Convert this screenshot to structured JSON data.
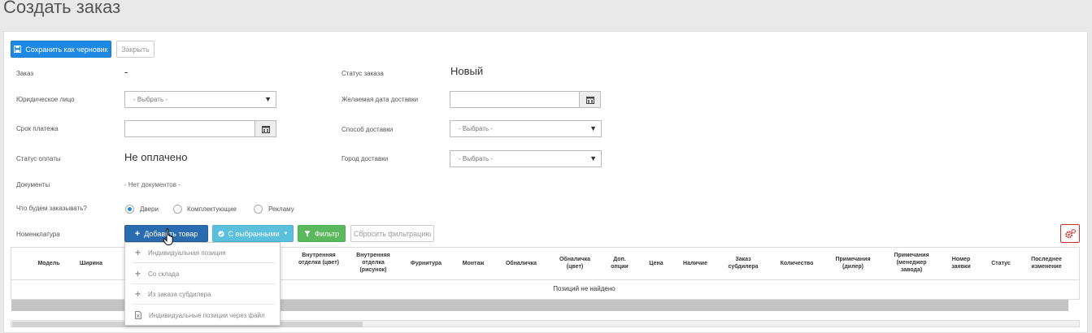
{
  "page": {
    "title": "Создать заказ"
  },
  "toolbar": {
    "save_draft_label": "Сохранить как черновик",
    "close_label": "Закрыть"
  },
  "form": {
    "order_label": "Заказ",
    "order_value": "-",
    "legal_entity_label": "Юридическое лицо",
    "legal_entity_value": "- Выбрать -",
    "payment_term_label": "Срок платежа",
    "payment_term_value": "",
    "payment_status_label": "Статус оплаты",
    "payment_status_value": "Не оплачено",
    "documents_label": "Документы",
    "documents_value": "- Нет документов -",
    "order_what_label": "Что будем заказывать?",
    "order_what_options": [
      "Двери",
      "Комплектующие",
      "Рекламу"
    ],
    "order_what_selected": "Двери",
    "nomenclature_label": "Номенклатура",
    "order_status_label": "Статус заказа",
    "order_status_value": "Новый",
    "desired_date_label": "Желаемая дата доставки",
    "desired_date_value": "",
    "delivery_method_label": "Способ доставки",
    "delivery_method_value": "- Выбрать -",
    "delivery_city_label": "Город доставки",
    "delivery_city_value": "- Выбрать -"
  },
  "actions": {
    "add_product_label": "Добавить товар",
    "with_selected_label": "С выбранными",
    "filter_label": "Фильтр",
    "reset_filter_label": "Сбросить фильтрацию"
  },
  "dropdown": {
    "items": [
      "Индивидуальная позиция",
      "Со склада",
      "Из заказа субдилера",
      "Индивидуальные позиции через файл"
    ]
  },
  "table": {
    "columns": [
      "Модель",
      "Ширина",
      "Внутренняя отделка (цвет)",
      "Внутренняя отделка (рисунок)",
      "Фурнитура",
      "Монтаж",
      "Обналичка",
      "Обналичка (цвет)",
      "Доп. опции",
      "Цена",
      "Наличие",
      "Заказ субдилера",
      "Количество",
      "Примечания (дилер)",
      "Примечания (менеджер завода)",
      "Номер заявки",
      "Статус",
      "Последнее изменение"
    ],
    "empty_text": "Позиций не найдено"
  },
  "icons": {
    "save": "floppy-icon",
    "calendar": "calendar-icon",
    "caret": "caret-down-icon",
    "plus": "plus-icon",
    "check": "check-circle-icon",
    "filter": "filter-icon",
    "gears": "gears-icon",
    "file": "excel-file-icon",
    "cursor": "hand-cursor-icon"
  },
  "colors": {
    "primary": "#1e88e5",
    "success": "#5cb85c",
    "info": "#5bc0de",
    "danger": "#c9302c"
  }
}
